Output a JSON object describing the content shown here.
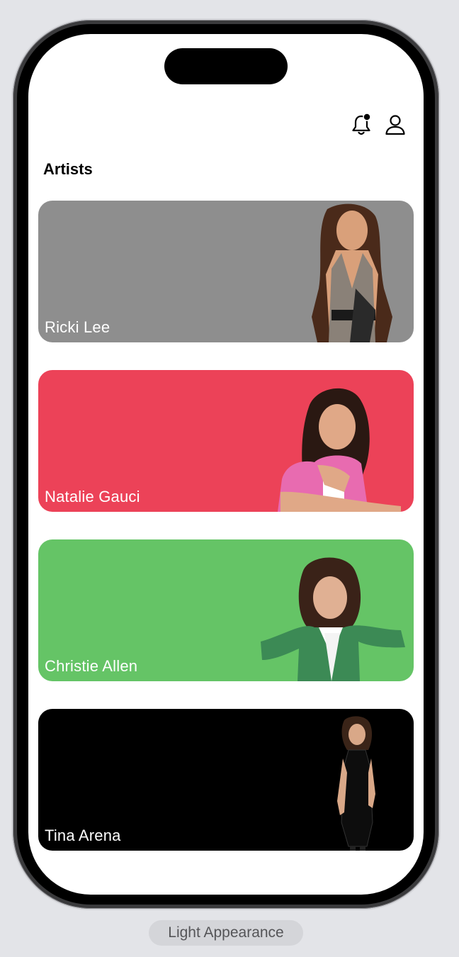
{
  "header": {
    "icons": [
      "bell-notification-icon",
      "person-icon"
    ]
  },
  "section": {
    "title": "Artists"
  },
  "artists": [
    {
      "name": "Ricki Lee",
      "color": "#8e8e8e"
    },
    {
      "name": "Natalie Gauci",
      "color": "#ec4258"
    },
    {
      "name": "Christie Allen",
      "color": "#65c466"
    },
    {
      "name": "Tina Arena",
      "color": "#000000"
    }
  ],
  "footer": {
    "caption": "Light Appearance"
  }
}
